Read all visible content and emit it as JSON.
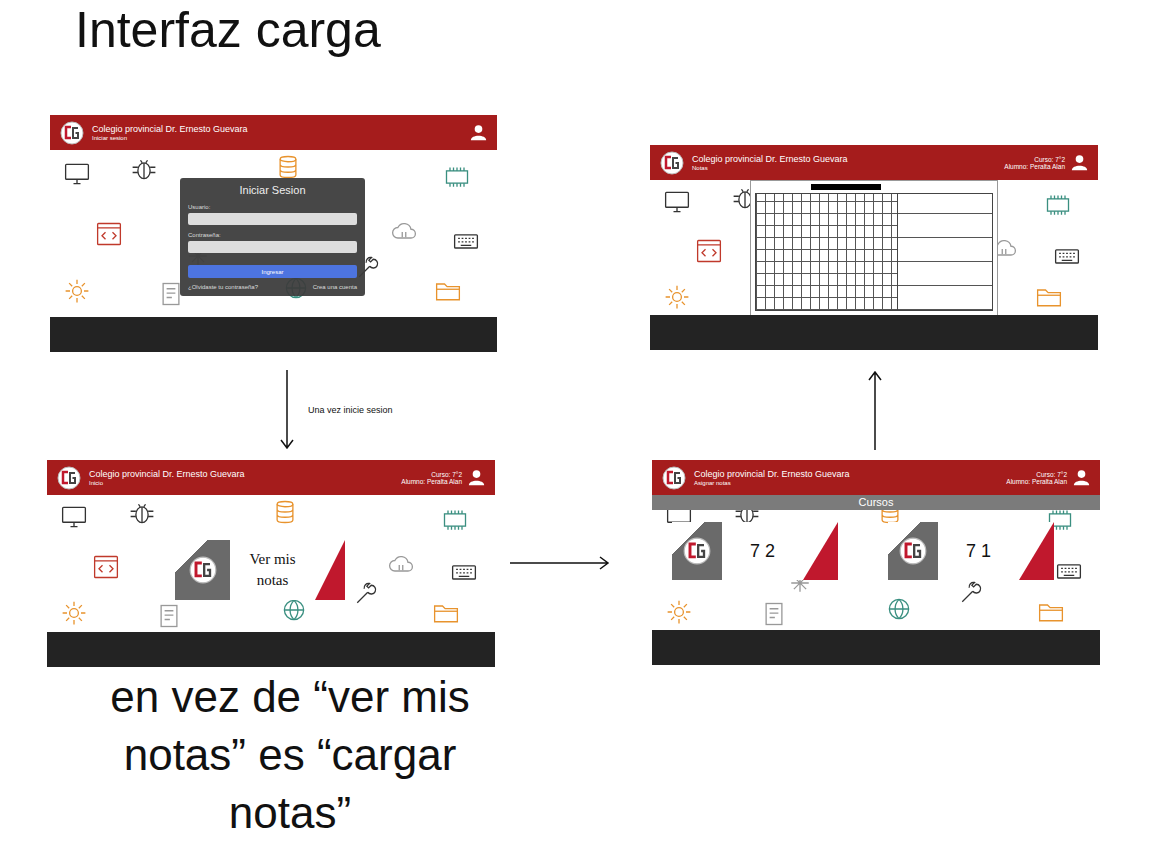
{
  "title": "Interfaz carga",
  "screens": [
    {
      "kind": "login",
      "header": {
        "school": "Colegio provincial Dr. Ernesto Guevara",
        "page": "Iniciar sesion"
      },
      "dialog": {
        "title": "Iniciar Sesion",
        "fields": [
          {
            "label": "Usuario:",
            "value": ""
          },
          {
            "label": "Contraseña:",
            "value": ""
          }
        ],
        "submit": "Ingresar",
        "links": [
          "¿Olvidaste tu contraseña?",
          "Crea una cuenta"
        ]
      }
    },
    {
      "kind": "home",
      "header": {
        "school": "Colegio provincial Dr. Ernesto Guevara",
        "page": "Inicio",
        "course": "Curso: 7°2",
        "student": "Alumno: Peralta Alan"
      },
      "card": "Ver mis notas"
    },
    {
      "kind": "courses",
      "header": {
        "school": "Colegio provincial Dr. Ernesto Guevara",
        "page": "Asignar notas",
        "course": "Curso: 7°2",
        "student": "Alumno: Peralta Alan"
      },
      "section": "Cursos",
      "courses": [
        "7 2",
        "7 1"
      ]
    },
    {
      "kind": "grades",
      "header": {
        "school": "Colegio provincial Dr. Ernesto Guevara",
        "page": "Notas",
        "course": "Curso: 7°2",
        "student": "Alumno: Peralta Alan"
      }
    }
  ],
  "arrows": [
    {
      "kind": "down",
      "label": "Una vez inicie sesion"
    },
    {
      "kind": "right"
    },
    {
      "kind": "up"
    }
  ],
  "note": "en vez de “ver mis notas” es “cargar notas”"
}
